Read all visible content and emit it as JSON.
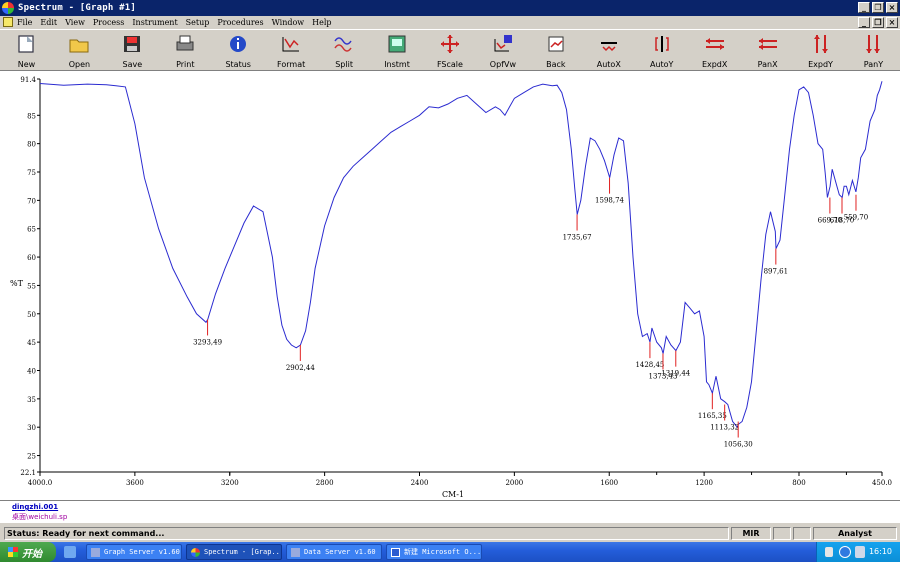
{
  "window": {
    "title": "Spectrum - [Graph #1]"
  },
  "menu": [
    "File",
    "Edit",
    "View",
    "Process",
    "Instrument",
    "Setup",
    "Procedures",
    "Window",
    "Help"
  ],
  "toolbar": [
    {
      "label": "New",
      "icon": "new-document-icon"
    },
    {
      "label": "Open",
      "icon": "open-folder-icon"
    },
    {
      "label": "Save",
      "icon": "save-disk-icon"
    },
    {
      "label": "Print",
      "icon": "printer-icon"
    },
    {
      "label": "Status",
      "icon": "info-icon"
    },
    {
      "label": "Format",
      "icon": "format-icon"
    },
    {
      "label": "Split",
      "icon": "split-icon"
    },
    {
      "label": "Instmt",
      "icon": "instrument-icon"
    },
    {
      "label": "FScale",
      "icon": "full-scale-icon"
    },
    {
      "label": "OpfVw",
      "icon": "overlay-view-icon"
    },
    {
      "label": "Back",
      "icon": "back-icon"
    },
    {
      "label": "AutoX",
      "icon": "auto-x-icon"
    },
    {
      "label": "AutoY",
      "icon": "auto-y-icon"
    },
    {
      "label": "ExpdX",
      "icon": "expand-x-icon"
    },
    {
      "label": "PanX",
      "icon": "pan-x-icon"
    },
    {
      "label": "ExpdY",
      "icon": "expand-y-icon"
    },
    {
      "label": "PanY",
      "icon": "pan-y-icon"
    }
  ],
  "file": {
    "name": "dingzhi.001",
    "path": "桌面\\weichuli.sp"
  },
  "status": {
    "text": "Status: Ready for next command...",
    "mode": "MIR",
    "role": "Analyst"
  },
  "taskbar": {
    "start": "开始",
    "tasks": [
      "Graph Server v1.60",
      "Spectrum - [Grap...",
      "Data Server v1.60",
      "新建 Microsoft O..."
    ],
    "clock": "16:10"
  },
  "colors": {
    "trace": "#2b2bd0",
    "peak_marker": "#e02020"
  },
  "chart_data": {
    "type": "line",
    "xlabel": "CM-1",
    "ylabel": "%T",
    "xlim": [
      4000,
      450
    ],
    "ylim": [
      22.1,
      91.4
    ],
    "xticks": [
      "4000.0",
      "3600",
      "3200",
      "2800",
      "2400",
      "2000",
      "1600",
      "1200",
      "800",
      "450.0"
    ],
    "xticks_minor": [
      "3200",
      "1400",
      "1000",
      "600"
    ],
    "yticks": [
      "91.4",
      "85",
      "80",
      "75",
      "70",
      "65",
      "60",
      "55",
      "50",
      "45",
      "40",
      "35",
      "30",
      "25",
      "22.1"
    ],
    "series": [
      {
        "x": [
          4000,
          3900,
          3800,
          3720,
          3680,
          3640,
          3600,
          3560,
          3500,
          3440,
          3380,
          3340,
          3300,
          3293,
          3260,
          3220,
          3180,
          3140,
          3100,
          3060,
          3020,
          3000,
          2980,
          2960,
          2940,
          2920,
          2902,
          2880,
          2860,
          2840,
          2800,
          2760,
          2720,
          2680,
          2640,
          2600,
          2560,
          2520,
          2480,
          2440,
          2400,
          2360,
          2320,
          2280,
          2240,
          2200,
          2160,
          2120,
          2080,
          2060,
          2040,
          2020,
          2000,
          1960,
          1920,
          1880,
          1840,
          1820,
          1800,
          1780,
          1760,
          1745,
          1735,
          1720,
          1700,
          1680,
          1660,
          1640,
          1620,
          1600,
          1598,
          1580,
          1560,
          1540,
          1520,
          1500,
          1480,
          1460,
          1440,
          1428,
          1420,
          1400,
          1380,
          1373,
          1360,
          1340,
          1319,
          1300,
          1280,
          1260,
          1240,
          1220,
          1200,
          1190,
          1180,
          1165,
          1150,
          1130,
          1113,
          1100,
          1080,
          1060,
          1056,
          1040,
          1020,
          1000,
          980,
          960,
          940,
          920,
          900,
          897,
          880,
          860,
          840,
          820,
          800,
          780,
          760,
          740,
          720,
          700,
          690,
          680,
          669,
          660,
          640,
          630,
          618,
          610,
          600,
          590,
          575,
          560,
          550,
          540,
          520,
          500,
          480,
          470,
          460,
          450
        ],
        "y": [
          90.6,
          90.3,
          90.5,
          90.4,
          90.2,
          90.0,
          83.5,
          74.0,
          65.0,
          58.0,
          53.0,
          50.0,
          48.5,
          49.0,
          53.5,
          58.0,
          62.0,
          66.0,
          69.0,
          68.0,
          60.0,
          53.0,
          48.0,
          45.5,
          44.5,
          44.0,
          44.5,
          47.0,
          52.0,
          58.0,
          65.5,
          70.5,
          74.0,
          76.0,
          77.5,
          79.0,
          80.5,
          82.0,
          83.0,
          84.0,
          85.0,
          86.5,
          86.3,
          87.0,
          88.0,
          88.5,
          87.0,
          85.5,
          86.5,
          86.0,
          85.0,
          86.5,
          88.0,
          89.0,
          90.0,
          90.5,
          90.2,
          90.3,
          89.0,
          86.0,
          79.0,
          72.0,
          67.5,
          70.0,
          76.0,
          81.0,
          80.5,
          79.0,
          77.0,
          74.3,
          74.0,
          78.0,
          81.0,
          80.5,
          73.0,
          60.0,
          50.0,
          46.0,
          46.5,
          45.0,
          47.5,
          45.0,
          44.0,
          43.0,
          46.0,
          44.5,
          43.5,
          45.0,
          52.0,
          51.0,
          50.0,
          50.5,
          46.0,
          38.0,
          37.5,
          36.0,
          39.0,
          35.0,
          34.5,
          34.0,
          31.0,
          30.0,
          30.5,
          31.0,
          33.5,
          38.0,
          47.0,
          56.0,
          64.0,
          68.0,
          64.5,
          61.5,
          63.0,
          71.0,
          79.0,
          85.0,
          89.5,
          90.0,
          89.0,
          85.0,
          80.0,
          79.0,
          75.0,
          70.5,
          72.5,
          75.5,
          72.5,
          71.0,
          70.5,
          72.5,
          72.5,
          71.0,
          73.5,
          71.5,
          74.0,
          77.5,
          79.0,
          84.0,
          86.0,
          88.5,
          89.5,
          91.0
        ],
        "color": "#2b2bd0"
      }
    ],
    "peaks": [
      {
        "x": 3293.49,
        "y": 49.0,
        "label": "3293,49"
      },
      {
        "x": 2902.44,
        "y": 44.5,
        "label": "2902,44"
      },
      {
        "x": 1735.67,
        "y": 67.5,
        "label": "1735,67"
      },
      {
        "x": 1598.74,
        "y": 74.0,
        "label": "1598,74"
      },
      {
        "x": 1428.45,
        "y": 45.0,
        "label": "1428,45"
      },
      {
        "x": 1373.43,
        "y": 43.0,
        "label": "1373,43"
      },
      {
        "x": 1319.44,
        "y": 43.5,
        "label": "1319,44"
      },
      {
        "x": 1165.35,
        "y": 36.0,
        "label": "1165,35"
      },
      {
        "x": 1113.32,
        "y": 34.0,
        "label": "1113,32"
      },
      {
        "x": 1056.3,
        "y": 31.0,
        "label": "1056,30"
      },
      {
        "x": 897.61,
        "y": 61.5,
        "label": "897,61"
      },
      {
        "x": 669.7,
        "y": 70.5,
        "label": "669,70"
      },
      {
        "x": 618.7,
        "y": 70.5,
        "label": "618,70"
      },
      {
        "x": 559.7,
        "y": 71.0,
        "label": "559,70"
      }
    ]
  }
}
